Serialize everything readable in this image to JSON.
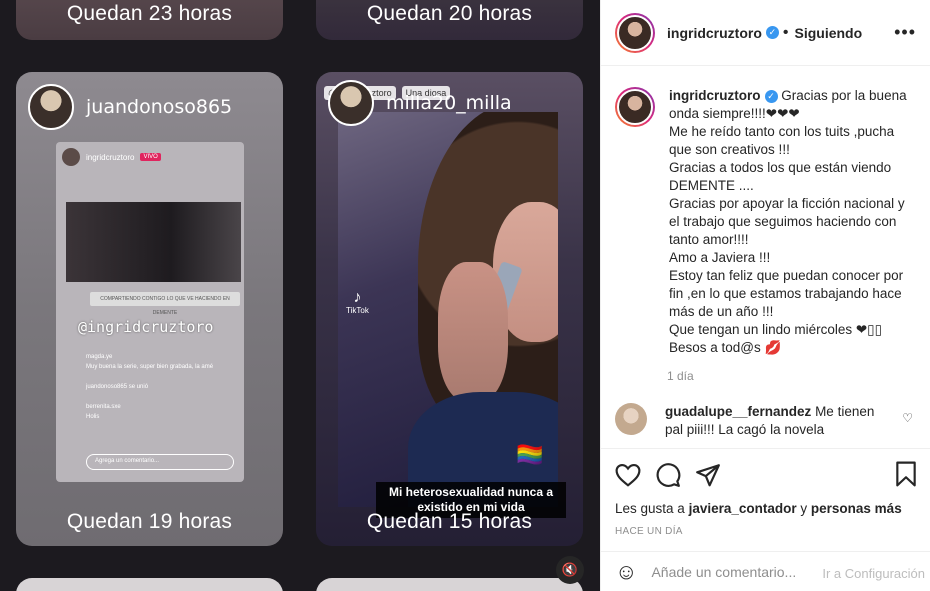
{
  "stories": {
    "top_left_remaining": "Quedan 23 horas",
    "top_right_remaining": "Quedan 20 horas",
    "left": {
      "username": "juandonoso865",
      "remaining": "Quedan 19 horas",
      "inner": {
        "handle": "ingridcruztoro",
        "live_badge": "VIVO",
        "mention": "@ingridcruztoro",
        "banner": "COMPARTIENDO CONTIGO LO QUE VE HACIENDO EN DEMENTE",
        "comments": [
          "magda.ye",
          "Muy buena la serie, super bien grabada, la amé",
          "juandonoso865 se unió",
          "berrenita.sxe",
          "Holis"
        ],
        "input_placeholder": "Agrega un comentario..."
      }
    },
    "right": {
      "username": "milla20_milla",
      "remaining": "Quedan 15 horas",
      "tags": [
        "@ingridcruztoro",
        "Una diosa"
      ],
      "tiktok_label": "TikTok",
      "caption": "Mi heterosexualidad nunca a existido en mi vida"
    }
  },
  "post": {
    "author": "ingridcruztoro",
    "following_label": "Siguiendo",
    "caption_lines": [
      "Gracias por la buena onda siempre!!!!❤❤❤",
      "Me he reído tanto con los tuits ,pucha que son creativos !!!",
      "Gracias a todos los que están viendo DEMENTE ....",
      "Gracias por apoyar la ficción nacional y el trabajo que seguimos haciendo con tanto amor!!!!",
      "Amo a Javiera !!!",
      "Estoy tan feliz que puedan conocer por fin ,en lo que estamos trabajando hace más de un año !!!",
      "Que tengan un lindo miércoles ❤▯▯",
      "Besos a tod@s 💋"
    ],
    "caption_time": "1 día",
    "comments": [
      {
        "user": "guadalupe__fernandez",
        "text": "Me tienen pal piii!!! La cagó la novela"
      }
    ],
    "likes_prefix": "Les gusta a",
    "likes_user": "javiera_contador",
    "likes_conj": "y",
    "likes_more": "personas más",
    "time_caps": "HACE UN DÍA",
    "add_comment_placeholder": "Añade un comentario...",
    "watermark": "Ir a Configuración"
  },
  "icons": [
    "more-icon",
    "heart-icon",
    "comment-icon",
    "share-icon",
    "bookmark-icon",
    "smile-icon",
    "mute-icon",
    "verified-icon"
  ],
  "colors": {
    "verified": "#3897f0",
    "media_bg": "#1c1a1f",
    "live": "#e0245e"
  }
}
